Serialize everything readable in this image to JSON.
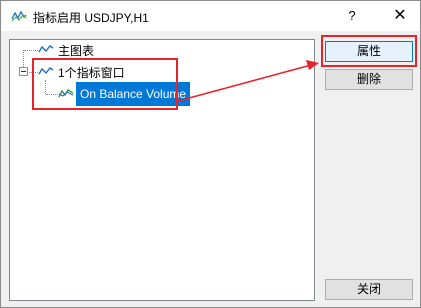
{
  "window": {
    "title": "指标启用 USDJPY,H1",
    "help_label": "?",
    "close_label": "✕"
  },
  "tree": {
    "items": [
      {
        "label": "主图表",
        "icon": "indicator-line-icon"
      },
      {
        "label": "1个指标窗口",
        "icon": "indicator-line-icon"
      },
      {
        "label": "On Balance Volume",
        "icon": "obv-indicator-icon",
        "selected": true
      }
    ]
  },
  "buttons": {
    "properties_label": "属性",
    "delete_label": "删除",
    "close_label": "关闭"
  },
  "colors": {
    "accent": "#0078d7",
    "highlight_annotation": "#e8232a"
  }
}
